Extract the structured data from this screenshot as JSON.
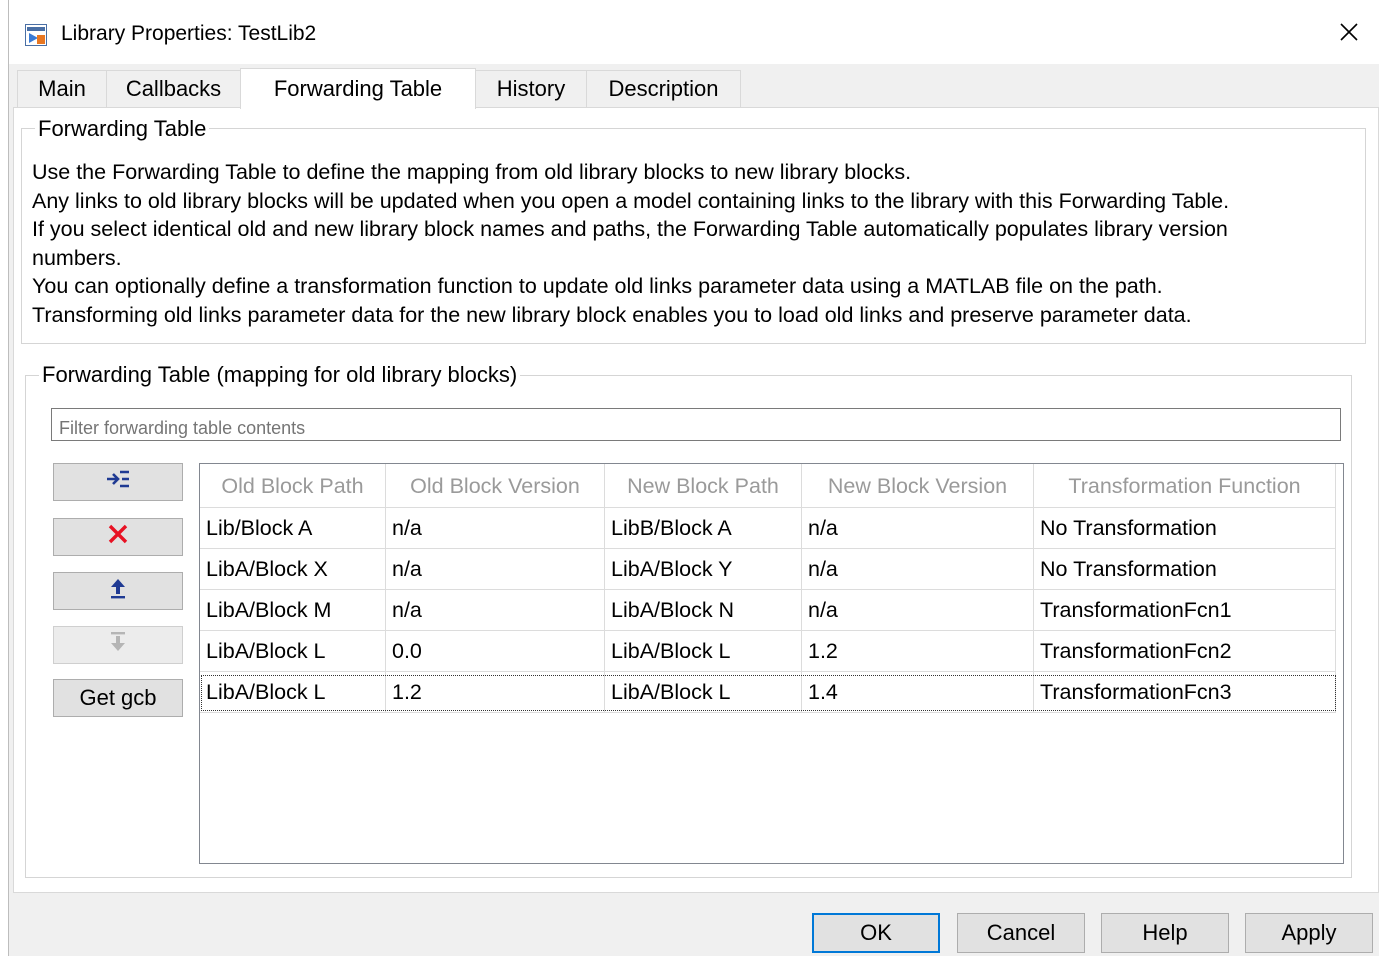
{
  "window": {
    "title": "Library Properties: TestLib2"
  },
  "tabs": [
    {
      "label": "Main"
    },
    {
      "label": "Callbacks"
    },
    {
      "label": "Forwarding Table",
      "active": true
    },
    {
      "label": "History"
    },
    {
      "label": "Description"
    }
  ],
  "info_group": {
    "label": "Forwarding Table",
    "lines": [
      "Use the Forwarding Table to define the mapping from old library blocks to new library blocks.",
      "Any links to old library blocks will be updated when you open a model containing links to the library with this Forwarding Table.",
      "If you select identical old and new library block names and paths, the Forwarding Table automatically populates library version",
      "numbers.",
      "You can optionally define a transformation function to update old links parameter data using a MATLAB file on the path.",
      "Transforming old links parameter data for the new library block enables you to load old links and preserve parameter data."
    ]
  },
  "table_group": {
    "label": "Forwarding Table (mapping for old library blocks)",
    "filter_placeholder": "Filter forwarding table contents",
    "side_buttons": [
      {
        "icon": "add-row-icon",
        "enabled": true
      },
      {
        "icon": "delete-row-icon",
        "enabled": true
      },
      {
        "icon": "move-up-icon",
        "enabled": true
      },
      {
        "icon": "move-down-icon",
        "enabled": false
      },
      {
        "label": "Get gcb",
        "enabled": true
      }
    ],
    "columns": [
      "Old Block Path",
      "Old Block Version",
      "New Block Path",
      "New Block Version",
      "Transformation Function"
    ],
    "rows": [
      [
        "Lib/Block A",
        "n/a",
        "LibB/Block A",
        "n/a",
        "No Transformation"
      ],
      [
        "LibA/Block X",
        "n/a",
        "LibA/Block Y",
        "n/a",
        "No Transformation"
      ],
      [
        "LibA/Block M",
        "n/a",
        "LibA/Block N",
        "n/a",
        "TransformationFcn1"
      ],
      [
        "LibA/Block L",
        "0.0",
        "LibA/Block L",
        "1.2",
        "TransformationFcn2"
      ],
      [
        "LibA/Block L",
        "1.2",
        "LibA/Block L",
        "1.4",
        "TransformationFcn3"
      ]
    ],
    "selected_row": 4
  },
  "footer": {
    "ok": "OK",
    "cancel": "Cancel",
    "help": "Help",
    "apply": "Apply"
  },
  "colors": {
    "accent": "#0078d7",
    "delete_icon": "#e81123",
    "arrow_icon": "#1f3a93",
    "header_text": "#9a9a9a"
  }
}
